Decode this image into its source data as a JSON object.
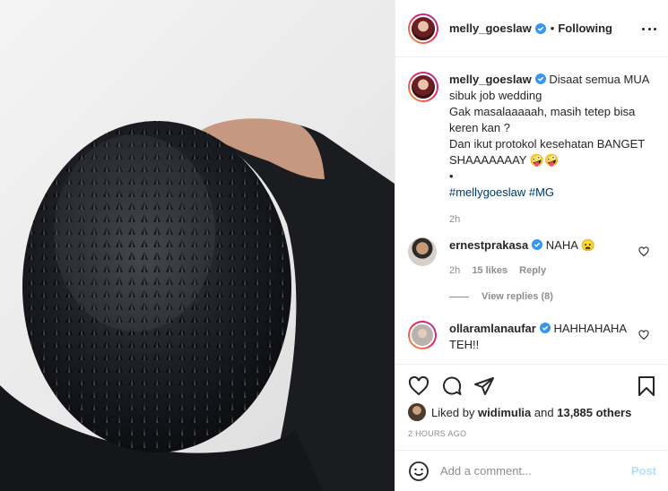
{
  "header": {
    "username": "melly_goeslaw",
    "separator": "•",
    "follow_state": "Following"
  },
  "caption": {
    "username": "melly_goeslaw",
    "lines": [
      "Disaat semua MUA",
      "sibuk job wedding",
      "Gak masalaaaaah, masih tetep bisa",
      "keren kan ?",
      "Dan ikut protokol kesehatan BANGET",
      "SHAAAAAAAY 🤪🤪",
      "•"
    ],
    "hashtags": "#mellygoeslaw #MG",
    "time": "2h"
  },
  "comments": [
    {
      "username": "ernestprakasa",
      "text": "NAHA 😦",
      "time": "2h",
      "likes": "15 likes",
      "reply_label": "Reply"
    },
    {
      "username": "ollaramlanaufar",
      "text": "HAHHAHAHA",
      "text2": "TEH!!"
    }
  ],
  "view_replies": "View replies (8)",
  "likes": {
    "prefix": "Liked by",
    "user": "widimulia",
    "conjunction": "and",
    "count": "13,885 others"
  },
  "time_ago": "2 HOURS AGO",
  "add_comment": {
    "placeholder": "Add a comment...",
    "post_label": "Post"
  },
  "colors": {
    "verified": "#3897f0",
    "link": "#00376b",
    "post_disabled": "#b2dffc"
  }
}
